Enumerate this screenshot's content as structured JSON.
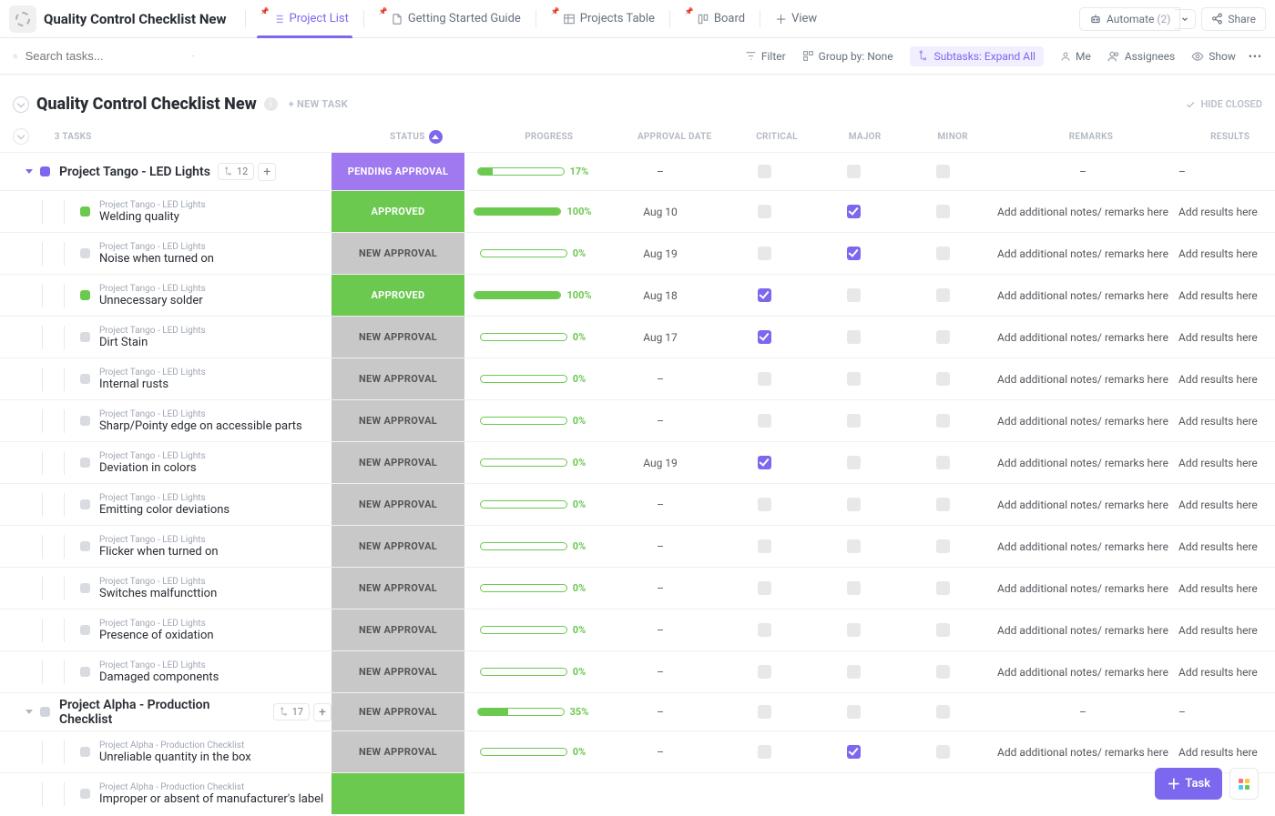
{
  "header": {
    "title": "Quality Control Checklist New",
    "views": [
      {
        "label": "Project List",
        "active": true,
        "icon": "list"
      },
      {
        "label": "Getting Started Guide",
        "active": false,
        "icon": "doc"
      },
      {
        "label": "Projects Table",
        "active": false,
        "icon": "table"
      },
      {
        "label": "Board",
        "active": false,
        "icon": "board"
      }
    ],
    "add_view": "View",
    "automate_label": "Automate",
    "automate_count": "(2)",
    "share_label": "Share"
  },
  "filter_bar": {
    "search_placeholder": "Search tasks...",
    "filter_label": "Filter",
    "group_label": "Group by: None",
    "subtasks_label": "Subtasks: Expand All",
    "me_label": "Me",
    "assignees_label": "Assignees",
    "show_label": "Show"
  },
  "section": {
    "title": "Quality Control Checklist New",
    "new_task": "+ NEW TASK",
    "hide_closed": "HIDE CLOSED",
    "task_count": "3 TASKS"
  },
  "columns": {
    "status": "STATUS",
    "progress": "PROGRESS",
    "approval_date": "APPROVAL DATE",
    "critical": "CRITICAL",
    "major": "MAJOR",
    "minor": "MINOR",
    "remarks": "REMARKS",
    "results": "RESULTS"
  },
  "remarks_placeholder": "Add additional notes/ remarks here",
  "results_placeholder": "Add results here",
  "groups": [
    {
      "title": "Project Tango - LED Lights",
      "color": "purple",
      "sub_count": "12",
      "status": "PENDING APPROVAL",
      "status_class": "st-pending",
      "progress": 17,
      "date": "–",
      "critical": false,
      "major": false,
      "minor": false,
      "remarks": "–",
      "results": "–",
      "tasks": [
        {
          "parent": "Project Tango - LED Lights",
          "name": "Welding quality",
          "dot": "green",
          "status": "APPROVED",
          "status_class": "st-approved",
          "progress": 100,
          "date": "Aug 10",
          "critical": false,
          "major": true,
          "minor": false
        },
        {
          "parent": "Project Tango - LED Lights",
          "name": "Noise when turned on",
          "dot": "grey",
          "status": "NEW APPROVAL",
          "status_class": "st-new",
          "progress": 0,
          "date": "Aug 19",
          "critical": false,
          "major": true,
          "minor": false
        },
        {
          "parent": "Project Tango - LED Lights",
          "name": "Unnecessary solder",
          "dot": "green",
          "status": "APPROVED",
          "status_class": "st-approved",
          "progress": 100,
          "date": "Aug 18",
          "critical": true,
          "major": false,
          "minor": false
        },
        {
          "parent": "Project Tango - LED Lights",
          "name": "Dirt Stain",
          "dot": "grey",
          "status": "NEW APPROVAL",
          "status_class": "st-new",
          "progress": 0,
          "date": "Aug 17",
          "critical": true,
          "major": false,
          "minor": false
        },
        {
          "parent": "Project Tango - LED Lights",
          "name": "Internal rusts",
          "dot": "grey",
          "status": "NEW APPROVAL",
          "status_class": "st-new",
          "progress": 0,
          "date": "–",
          "critical": false,
          "major": false,
          "minor": false
        },
        {
          "parent": "Project Tango - LED Lights",
          "name": "Sharp/Pointy edge on accessible parts",
          "dot": "grey",
          "status": "NEW APPROVAL",
          "status_class": "st-new",
          "progress": 0,
          "date": "–",
          "critical": false,
          "major": false,
          "minor": false
        },
        {
          "parent": "Project Tango - LED Lights",
          "name": "Deviation in colors",
          "dot": "grey",
          "status": "NEW APPROVAL",
          "status_class": "st-new",
          "progress": 0,
          "date": "Aug 19",
          "critical": true,
          "major": false,
          "minor": false
        },
        {
          "parent": "Project Tango - LED Lights",
          "name": "Emitting color deviations",
          "dot": "grey",
          "status": "NEW APPROVAL",
          "status_class": "st-new",
          "progress": 0,
          "date": "–",
          "critical": false,
          "major": false,
          "minor": false
        },
        {
          "parent": "Project Tango - LED Lights",
          "name": "Flicker when turned on",
          "dot": "grey",
          "status": "NEW APPROVAL",
          "status_class": "st-new",
          "progress": 0,
          "date": "–",
          "critical": false,
          "major": false,
          "minor": false
        },
        {
          "parent": "Project Tango - LED Lights",
          "name": "Switches malfuncttion",
          "dot": "grey",
          "status": "NEW APPROVAL",
          "status_class": "st-new",
          "progress": 0,
          "date": "–",
          "critical": false,
          "major": false,
          "minor": false
        },
        {
          "parent": "Project Tango - LED Lights",
          "name": "Presence of oxidation",
          "dot": "grey",
          "status": "NEW APPROVAL",
          "status_class": "st-new",
          "progress": 0,
          "date": "–",
          "critical": false,
          "major": false,
          "minor": false
        },
        {
          "parent": "Project Tango - LED Lights",
          "name": "Damaged components",
          "dot": "grey",
          "status": "NEW APPROVAL",
          "status_class": "st-new",
          "progress": 0,
          "date": "–",
          "critical": false,
          "major": false,
          "minor": false
        }
      ]
    },
    {
      "title": "Project Alpha - Production Checklist",
      "color": "grey",
      "sub_count": "17",
      "status": "NEW APPROVAL",
      "status_class": "st-new",
      "progress": 35,
      "date": "–",
      "critical": false,
      "major": false,
      "minor": false,
      "remarks": "–",
      "results": "–",
      "tasks": [
        {
          "parent": "Project Alpha - Production Checklist",
          "name": "Unreliable quantity in the box",
          "dot": "grey",
          "status": "NEW APPROVAL",
          "status_class": "st-new",
          "progress": 0,
          "date": "–",
          "critical": false,
          "major": true,
          "minor": false
        },
        {
          "parent": "Project Alpha - Production Checklist",
          "name": "Improper or absent of manufacturer's label",
          "dot": "grey",
          "status": "",
          "status_class": "st-approved",
          "progress": null,
          "date": "",
          "critical": null,
          "major": null,
          "minor": null
        }
      ]
    }
  ],
  "float": {
    "task_label": "Task"
  }
}
